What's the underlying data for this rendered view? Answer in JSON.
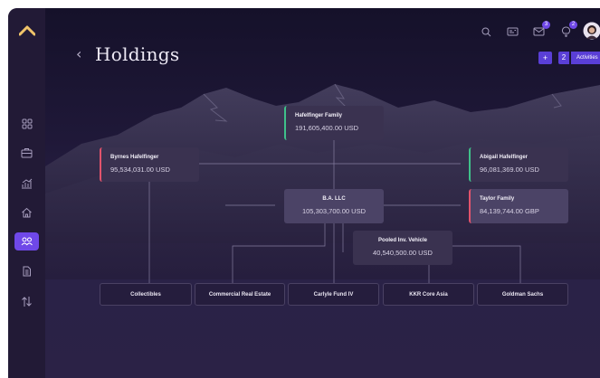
{
  "page": {
    "title": "Holdings"
  },
  "toolbar": {
    "add_label": "+",
    "activities_count": "2",
    "activities_label": "Activities"
  },
  "topbar": {
    "messages_badge": "3",
    "notifications_badge": "2"
  },
  "colors": {
    "accent": "#6f48e8",
    "positive": "#3fc08a",
    "negative": "#e2536c",
    "logo": "#f1c46a"
  },
  "sidebar": {
    "items": [
      {
        "icon": "grid-icon",
        "active": false
      },
      {
        "icon": "briefcase-icon",
        "active": false
      },
      {
        "icon": "chart-icon",
        "active": false
      },
      {
        "icon": "house-icon",
        "active": false
      },
      {
        "icon": "people-icon",
        "active": true
      },
      {
        "icon": "document-icon",
        "active": false
      },
      {
        "icon": "transfer-icon",
        "active": false
      }
    ]
  },
  "tree": {
    "root": {
      "name": "Hafelfinger Family",
      "value": "191,605,400.00 USD"
    },
    "left": {
      "name": "Byrnes Hafelfinger",
      "value": "95,534,031.00 USD"
    },
    "right_top": {
      "name": "Abigail Hafelfinger",
      "value": "96,081,369.00 USD"
    },
    "llc": {
      "name": "B.A. LLC",
      "value": "105,303,700.00 USD"
    },
    "right_mid": {
      "name": "Taylor Family",
      "value": "84,139,744.00 GBP"
    },
    "pooled": {
      "name": "Pooled Inv. Vehicle",
      "value": "40,540,500.00 USD"
    },
    "leaves": [
      "Collectibles",
      "Commercial Real Estate",
      "Carlyle Fund IV",
      "KKR Core Asia",
      "Goldman Sachs"
    ]
  }
}
